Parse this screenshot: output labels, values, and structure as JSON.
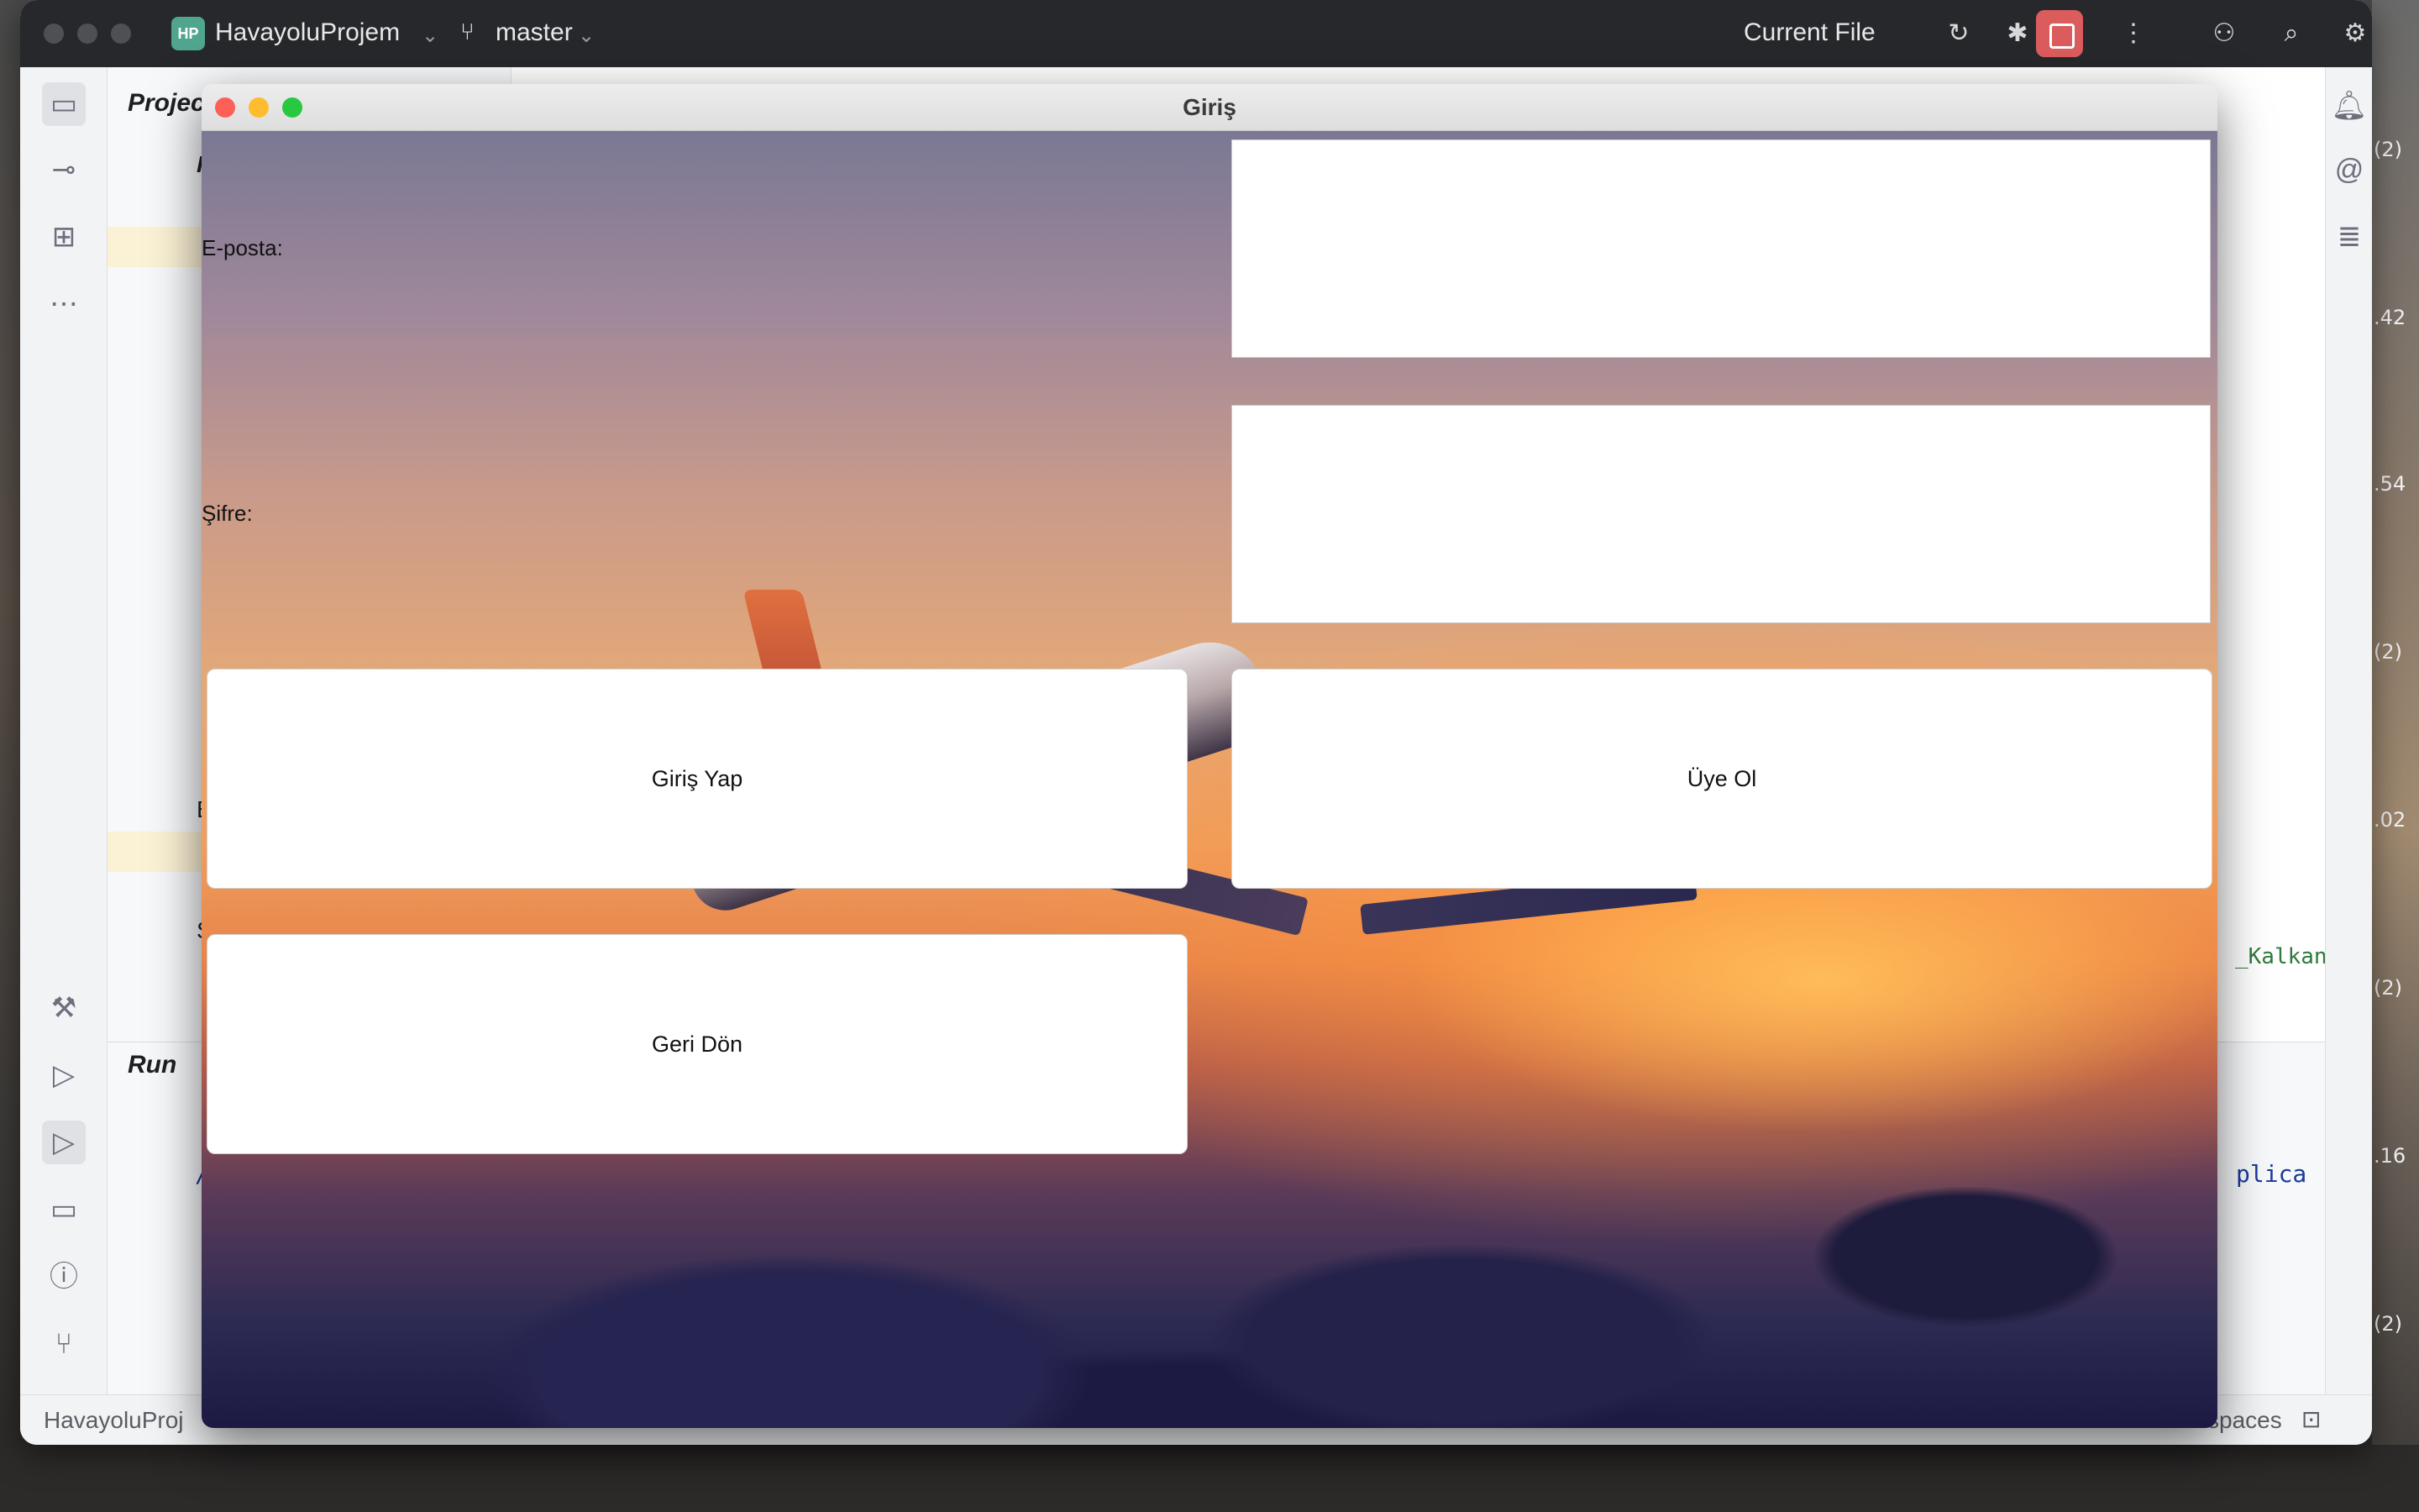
{
  "ide": {
    "project_name": "HavayoluProjem",
    "project_initials": "HP",
    "branch": "master",
    "run_config": "Current File",
    "project_panel_title": "Project",
    "run_panel_title": "Run",
    "status_project": "HavayoluProj",
    "status_right": "spaces",
    "tree_fragments": [
      "Ha",
      "Ex",
      "So"
    ],
    "console_fragment": "/L",
    "console_fragment_right": "plica",
    "editor_fragment": "_Kalkan"
  },
  "side_numbers": [
    "(2)",
    ".42",
    ".54",
    "(2)",
    ".02",
    "(2)",
    ".16",
    "(2)"
  ],
  "dialog": {
    "title": "Giriş",
    "email_label": "E-posta:",
    "email_value": "",
    "password_label": "Şifre:",
    "password_value": "",
    "login_button": "Giriş Yap",
    "signup_button": "Üye Ol",
    "back_button": "Geri Dön"
  },
  "icons": {
    "close": "close-light-icon",
    "minimize": "minimize-light-icon",
    "zoom": "zoom-light-icon",
    "branch": "git-branch-icon",
    "stop": "stop-icon"
  },
  "colors": {
    "close_light": "#fe5f57",
    "minimize_light": "#febc2e",
    "zoom_light": "#28c840",
    "stop_button": "#db5c5c",
    "ide_titlebar": "#27282c"
  }
}
